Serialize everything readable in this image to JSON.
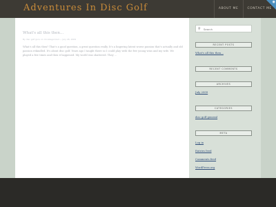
{
  "header": {
    "site_title": "Adventures In Disc Golf",
    "nav": [
      "ABOUT ME",
      "CONTACT ME"
    ],
    "corner_icon": "rss-icon"
  },
  "post": {
    "title": "What's all this then...",
    "meta": "By disc golf guru on Uncategorized — July 26, 2009",
    "excerpt": "What's all this then? That's a good question, a great question really. It's a lingering latent worse passion that's actually and old passion rekindled. It's about disc golf. Years ago I taught there so I could play with the few young wins and my wife. We played a few times and then it happened. My world was shattered. They …"
  },
  "sidebar": {
    "search_placeholder": "Search",
    "recent_posts": {
      "title": "RECENT POSTS",
      "items": [
        "What's all this then..."
      ]
    },
    "recent_comments": {
      "title": "RECENT COMMENTS"
    },
    "archives": {
      "title": "ARCHIVES",
      "items": [
        "July 2009"
      ]
    },
    "categories": {
      "title": "CATEGORIES",
      "items": [
        "disc golf general"
      ]
    },
    "meta": {
      "title": "META",
      "items": [
        "Log in",
        "Entries feed",
        "Comments feed",
        "WordPress.org"
      ]
    }
  },
  "colors": {
    "header_bg": "#3d3a34",
    "title_color": "#c98c3a",
    "sidebar_bg": "#d8e0d8",
    "footer_bg": "#2b2a27",
    "link_color": "#2f4d7a"
  }
}
